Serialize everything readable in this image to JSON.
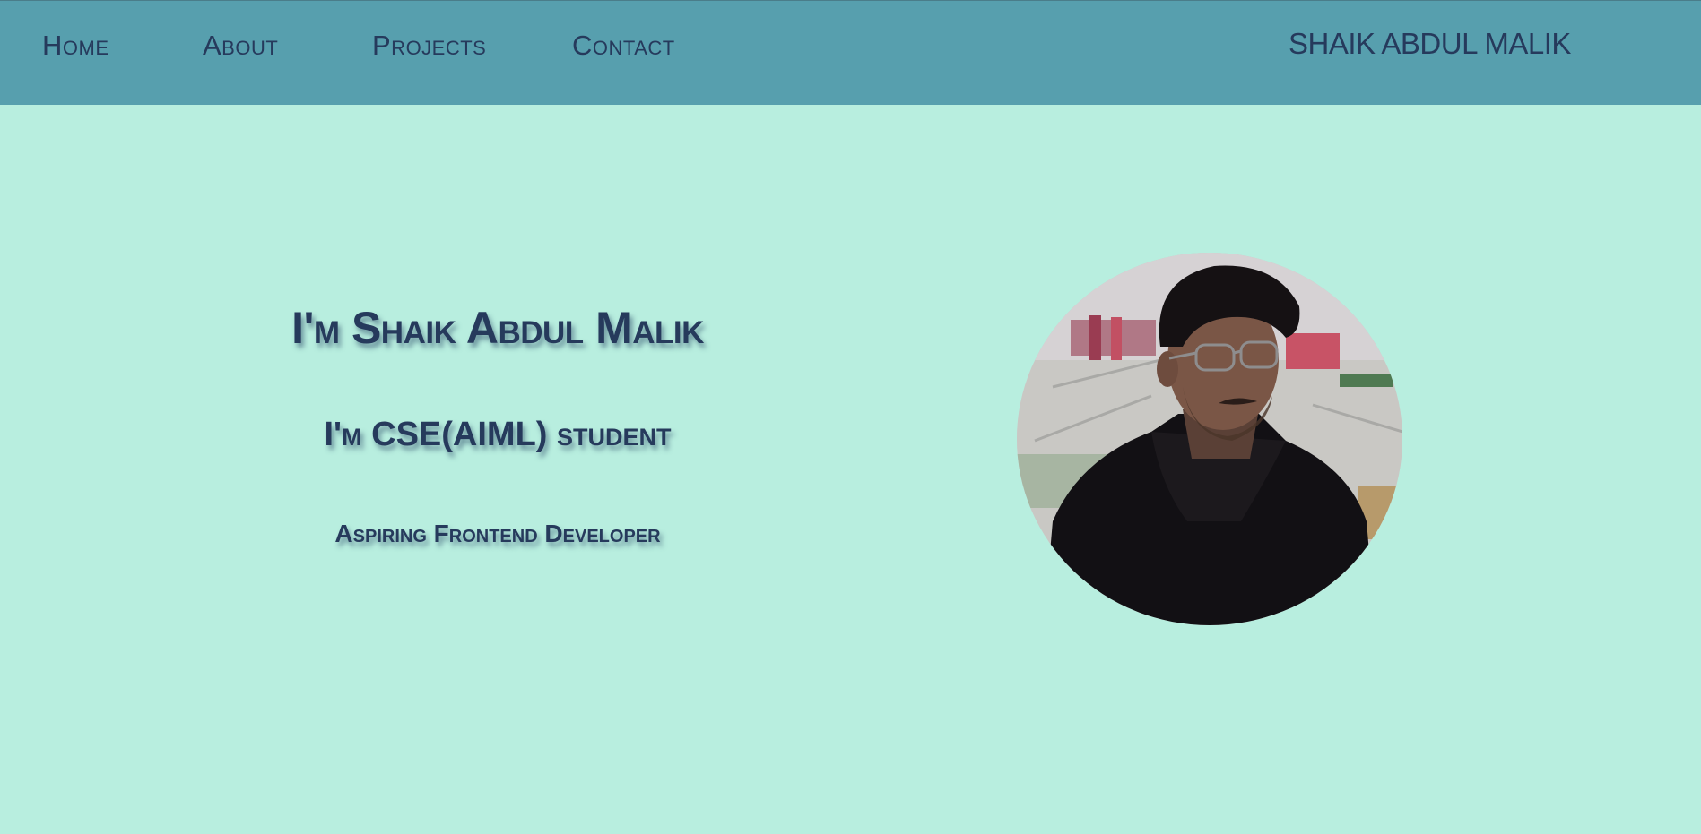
{
  "nav": {
    "items": [
      {
        "label": "Home"
      },
      {
        "label": "About"
      },
      {
        "label": "Projects"
      },
      {
        "label": "Contact"
      }
    ],
    "brand": "SHAIK ABDUL MALIK"
  },
  "hero": {
    "title": "I'm Shaik Abdul Malik",
    "subtitle": "I'm CSE(AIML) student",
    "role": "Aspiring Frontend Developer"
  },
  "profile_photo": {
    "subject": "man with glasses in dark hoodie"
  },
  "colors": {
    "background": "#b8eedf",
    "navbar": "#579fae",
    "text": "#263a5c"
  }
}
